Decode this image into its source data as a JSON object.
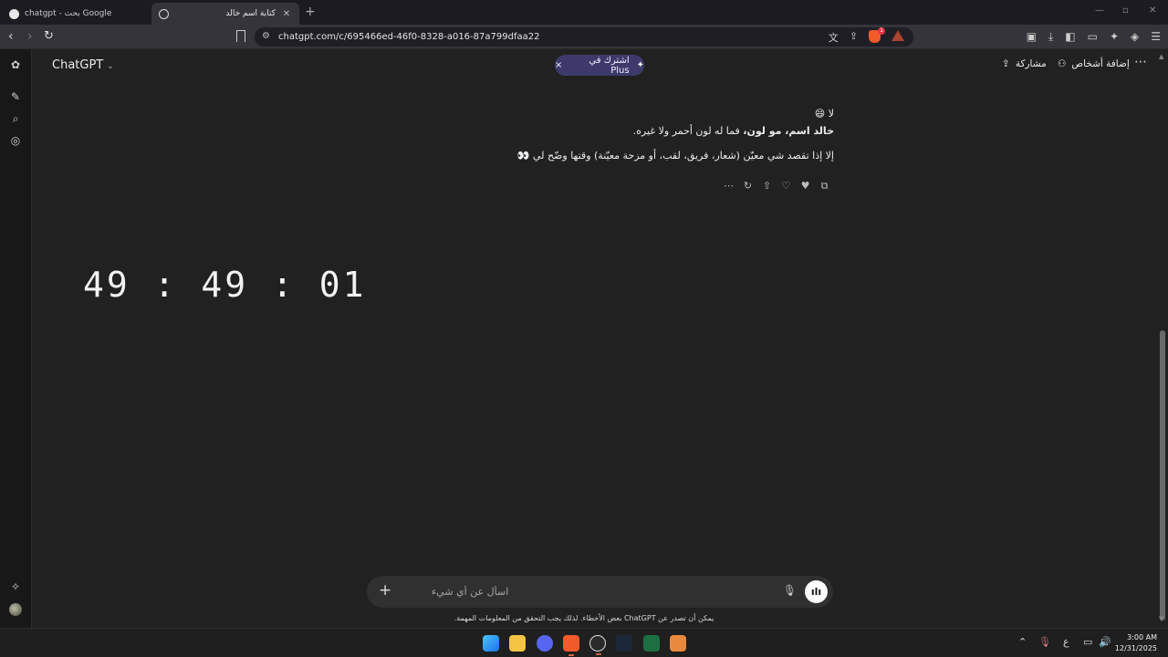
{
  "browser": {
    "tabs": [
      {
        "title": "chatgpt - بحث Google",
        "active": false
      },
      {
        "title": "كتابة اسم خالد",
        "active": true
      }
    ],
    "new_tab_label": "+",
    "url": "chatgpt.com/c/695466ed-46f0-8328-a016-87a799dfaa22",
    "brave_badge": "1"
  },
  "header": {
    "app_title": "ChatGPT",
    "plus_pill": "اشترك في Plus",
    "share_label": "مشاركة",
    "add_people_label": "إضافة أشخاص"
  },
  "message": {
    "line1": "لا 😄",
    "line2_bold": "خالد اسم، مو لون،",
    "line2_rest": " فما له لون أحمر ولا غيره.",
    "line3": "إلا إذا تقصد شي معيّن (شعار، فريق، لقب، أو مزحة معيّنة) وقتها وضّح لي 👀"
  },
  "clock_overlay": "49:49:01",
  "composer": {
    "placeholder": "اسأل عن أي شيء"
  },
  "disclaimer": "يمكن أن تصدر عن ChatGPT بعض الأخطاء. لذلك يجب التحقق من المعلومات المهمة.",
  "taskbar": {
    "lang": "ع",
    "time": "3:00 AM",
    "date": "12/31/2025"
  },
  "colors": {
    "background": "#212121",
    "plus_pill": "#3d3a6b",
    "brave": "#f15a2b"
  }
}
